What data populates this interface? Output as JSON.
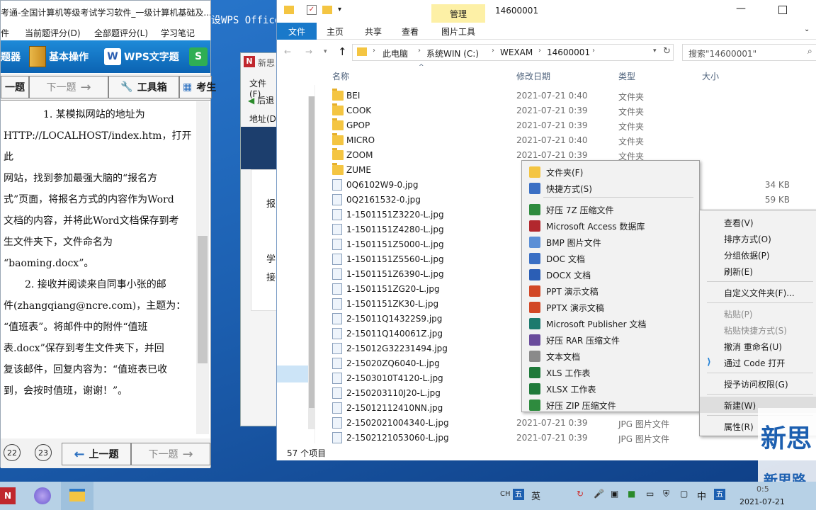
{
  "exam": {
    "title": "考通-全国计算机等级考试学习软件_一级计算机基础及...",
    "menu": [
      "件",
      "当前题评分(D)",
      "全部题评分(L)",
      "学习笔记"
    ],
    "toolbar": {
      "words": "题器",
      "basic": "基本操作",
      "wps": "WPS文字题"
    },
    "nav": {
      "prev": "一题",
      "next": "下一题",
      "tools": "工具箱",
      "exam": "考生"
    },
    "question_lines": [
      "1. 某模拟网站的地址为",
      "HTTP://LOCALHOST/index.htm，打开此",
      "网站，找到参加最强大脑的“报名方",
      "式”页面，将报名方式的内容作为Word",
      "文档的内容，并将此Word文档保存到考",
      "生文件夹下，文件命名为",
      "“baoming.docx”。",
      "2. 接收并阅读来自同事小张的邮",
      "件(zhangqiang@ncre.com)，主题为：",
      "“值班表”。将邮件中的附件“值班",
      "表.docx”保存到考生文件夹下，并回",
      "复该邮件，回复内容为：“值班表已收",
      "到，会按时值班，谢谢！”。"
    ],
    "bottom": {
      "n22": "22",
      "n23": "23",
      "prev": "上一题",
      "next": "下一题"
    }
  },
  "background_title": "设WPS Office",
  "midwin": {
    "title": "新思",
    "menu": "文件(F)",
    "back": "后退",
    "addr": "地址(D",
    "t1": "报",
    "t2": "学",
    "t3": "接"
  },
  "explorer": {
    "title": "14600001",
    "manage_tab": "管理",
    "tabs": [
      "文件",
      "主页",
      "共享",
      "查看",
      "图片工具"
    ],
    "breadcrumb": [
      "此电脑",
      "系统WIN (C:)",
      "WEXAM",
      "14600001"
    ],
    "search_placeholder": "搜索\"14600001\"",
    "columns": [
      "名称",
      "修改日期",
      "类型",
      "大小"
    ],
    "files": [
      {
        "name": "BEI",
        "date": "2021-07-21 0:40",
        "type": "文件夹",
        "size": "",
        "kind": "folder"
      },
      {
        "name": "COOK",
        "date": "2021-07-21 0:39",
        "type": "文件夹",
        "size": "",
        "kind": "folder"
      },
      {
        "name": "GPOP",
        "date": "2021-07-21 0:39",
        "type": "文件夹",
        "size": "",
        "kind": "folder"
      },
      {
        "name": "MICRO",
        "date": "2021-07-21 0:40",
        "type": "文件夹",
        "size": "",
        "kind": "folder"
      },
      {
        "name": "ZOOM",
        "date": "2021-07-21 0:39",
        "type": "文件夹",
        "size": "",
        "kind": "folder"
      },
      {
        "name": "ZUME",
        "date": "",
        "type": "",
        "size": "",
        "kind": "folder"
      },
      {
        "name": "0Q6102W9-0.jpg",
        "date": "",
        "type": "",
        "size": "34 KB",
        "kind": "jpg"
      },
      {
        "name": "0Q2161532-0.jpg",
        "date": "",
        "type": "",
        "size": "59 KB",
        "kind": "jpg"
      },
      {
        "name": "1-1501151Z3220-L.jpg",
        "date": "",
        "type": "",
        "size": "",
        "kind": "jpg"
      },
      {
        "name": "1-1501151Z4280-L.jpg",
        "date": "",
        "type": "",
        "size": "",
        "kind": "jpg"
      },
      {
        "name": "1-1501151Z5000-L.jpg",
        "date": "",
        "type": "",
        "size": "",
        "kind": "jpg"
      },
      {
        "name": "1-1501151Z5560-L.jpg",
        "date": "",
        "type": "",
        "size": "",
        "kind": "jpg"
      },
      {
        "name": "1-1501151Z6390-L.jpg",
        "date": "",
        "type": "",
        "size": "",
        "kind": "jpg"
      },
      {
        "name": "1-1501151ZG20-L.jpg",
        "date": "",
        "type": "",
        "size": "",
        "kind": "jpg"
      },
      {
        "name": "1-1501151ZK30-L.jpg",
        "date": "",
        "type": "",
        "size": "",
        "kind": "jpg"
      },
      {
        "name": "2-15011Q14322S9.jpg",
        "date": "",
        "type": "",
        "size": "",
        "kind": "jpg"
      },
      {
        "name": "2-15011Q140061Z.jpg",
        "date": "",
        "type": "",
        "size": "",
        "kind": "jpg"
      },
      {
        "name": "2-15012G32231494.jpg",
        "date": "",
        "type": "",
        "size": "",
        "kind": "jpg"
      },
      {
        "name": "2-15020ZQ6040-L.jpg",
        "date": "",
        "type": "",
        "size": "",
        "kind": "jpg"
      },
      {
        "name": "2-1503010T4120-L.jpg",
        "date": "",
        "type": "",
        "size": "",
        "kind": "jpg"
      },
      {
        "name": "2-150203110J20-L.jpg",
        "date": "",
        "type": "",
        "size": "",
        "kind": "jpg"
      },
      {
        "name": "2-15012112410NN.jpg",
        "date": "",
        "type": "",
        "size": "",
        "kind": "jpg"
      },
      {
        "name": "2-1502021004340-L.jpg",
        "date": "2021-07-21 0:39",
        "type": "JPG 图片文件",
        "size": "",
        "kind": "jpg"
      },
      {
        "name": "2-1502121053060-L.jpg",
        "date": "2021-07-21 0:39",
        "type": "JPG 图片文件",
        "size": "",
        "kind": "jpg"
      }
    ],
    "status": "57 个项目"
  },
  "context_menu": {
    "items": [
      "查看(V)",
      "排序方式(O)",
      "分组依据(P)",
      "刷新(E)",
      "自定义文件夹(F)...",
      "粘贴(P)",
      "粘贴快捷方式(S)",
      "撤消 重命名(U)",
      "通过 Code 打开",
      "授予访问权限(G)",
      "新建(W)",
      "属性(R)"
    ]
  },
  "new_submenu": {
    "items": [
      "文件夹(F)",
      "快捷方式(S)",
      "好压 7Z 压缩文件",
      "Microsoft Access 数据库",
      "BMP 图片文件",
      "DOC 文档",
      "DOCX 文档",
      "PPT 演示文稿",
      "PPTX 演示文稿",
      "Microsoft Publisher 文档",
      "好压 RAR 压缩文件",
      "文本文档",
      "XLS 工作表",
      "XLSX 工作表",
      "好压 ZIP 压缩文件"
    ],
    "icon_colors": [
      "#f4c542",
      "#3a6fc4",
      "#2e8b3e",
      "#b2282e",
      "#5b8fd6",
      "#3a6fc4",
      "#2b5eb5",
      "#d24726",
      "#d24726",
      "#1c7a6e",
      "#6a4c9c",
      "#8a8a8a",
      "#1f7a3a",
      "#1f7a3a",
      "#2e8b3e"
    ]
  },
  "taskbar": {
    "ime1": "CH",
    "ime2": "五",
    "ime3": "英",
    "ime4": "中",
    "ime5": "五",
    "date": "2021-07-21",
    "time": "0:5"
  },
  "watermark": {
    "text1": "新思",
    "text2": "新思路"
  }
}
